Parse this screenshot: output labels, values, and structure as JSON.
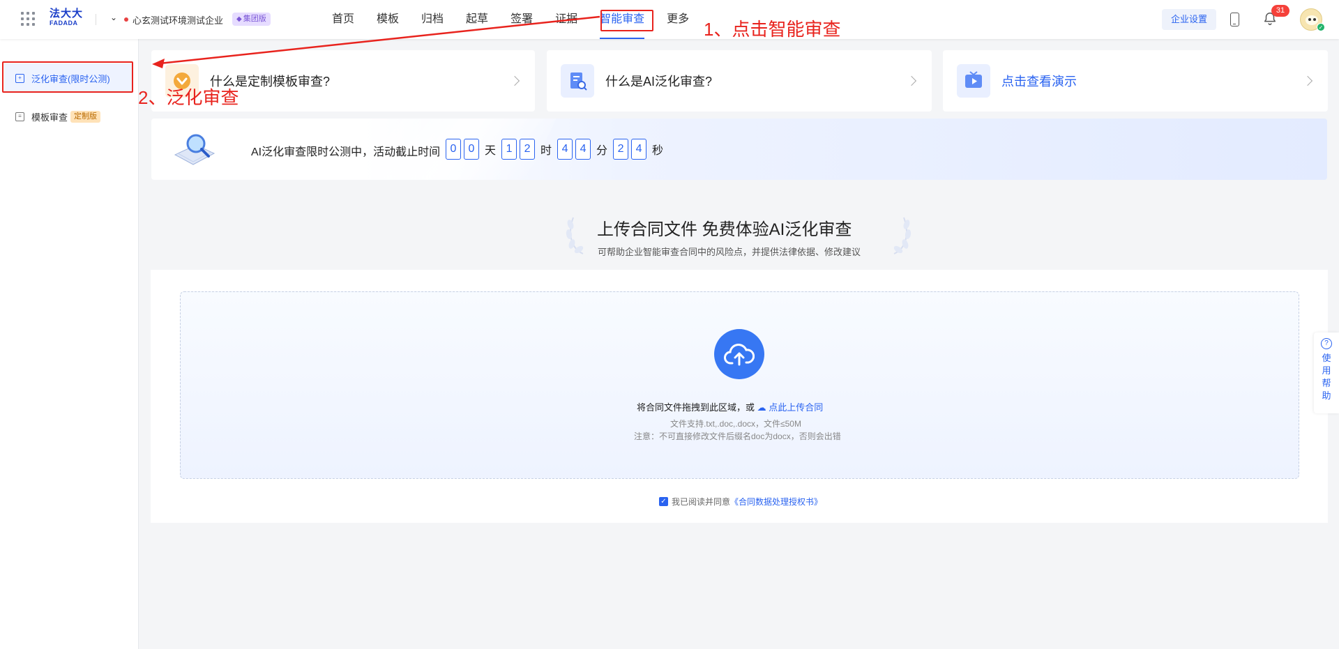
{
  "header": {
    "logo_cn": "法大大",
    "logo_en": "FADADA",
    "org_name": "心玄测试环境测试企业",
    "org_badge": "集团版",
    "nav": [
      "首页",
      "模板",
      "归档",
      "起草",
      "签署",
      "证据",
      "智能审查",
      "更多"
    ],
    "active_nav": "智能审查",
    "settings_label": "企业设置",
    "notification_count": "31"
  },
  "sidebar": {
    "items": [
      {
        "label": "泛化审查(限时公测)",
        "active": true
      },
      {
        "label": "模板审查",
        "tag": "定制版"
      }
    ]
  },
  "cards": [
    {
      "label": "什么是定制模板审查?"
    },
    {
      "label": "什么是AI泛化审查?"
    },
    {
      "label": "点击查看演示"
    }
  ],
  "banner": {
    "text": "AI泛化审查限时公测中，活动截止时间",
    "days": [
      "0",
      "0"
    ],
    "days_unit": "天",
    "hours": [
      "1",
      "2"
    ],
    "hours_unit": "时",
    "minutes": [
      "4",
      "4"
    ],
    "minutes_unit": "分",
    "seconds": [
      "2",
      "4"
    ],
    "seconds_unit": "秒"
  },
  "upload": {
    "title": "上传合同文件 免费体验AI泛化审查",
    "subtitle": "可帮助企业智能审查合同中的风险点，并提供法律依据、修改建议",
    "drop_text": "将合同文件拖拽到此区域，或",
    "upload_link": "点此上传合同",
    "hint1": "文件支持.txt,.doc,.docx，文件≤50M",
    "hint2": "注意：不可直接修改文件后缀名doc为docx，否则会出错",
    "agree_prefix": "我已阅读并同意",
    "agree_link": "《合同数据处理授权书》",
    "agree_checked": true
  },
  "help": {
    "chars": [
      "使",
      "用",
      "帮",
      "助"
    ]
  },
  "annotations": {
    "step1": "1、点击智能审查",
    "step2": "2、泛化审查"
  },
  "colors": {
    "accent": "#2a63f0",
    "annotation_red": "#e8231d",
    "badge_red": "#f5413a"
  }
}
